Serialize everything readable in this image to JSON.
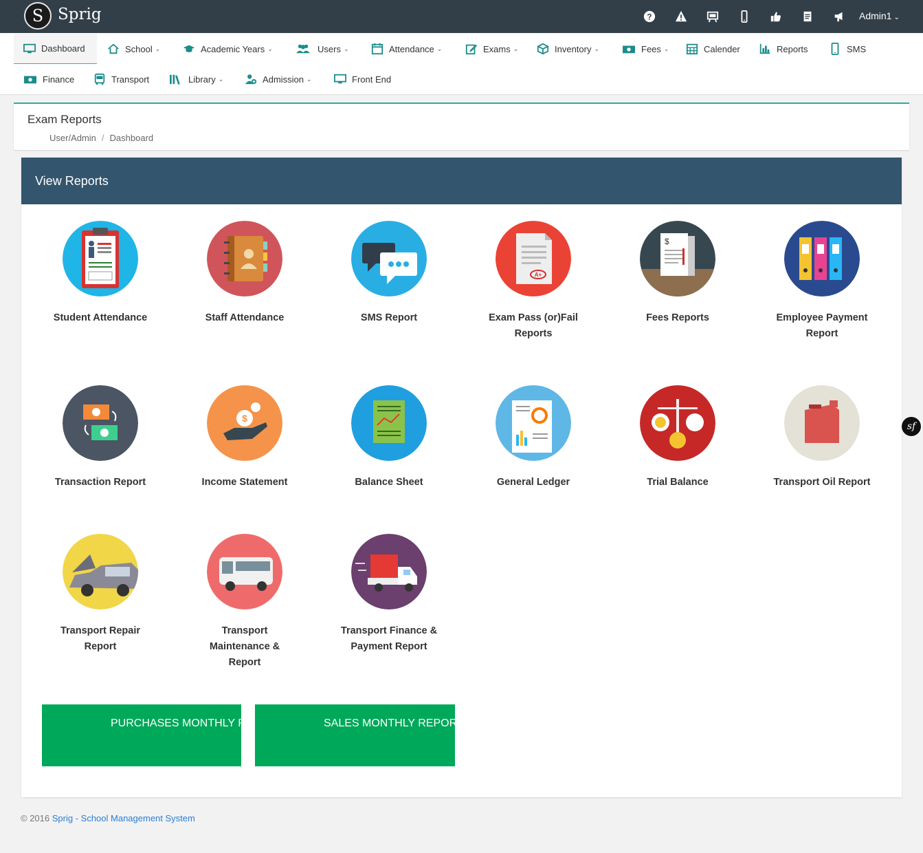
{
  "app": {
    "brand": "Sprig",
    "logo_letter": "S"
  },
  "topbar": {
    "icons": [
      "help-icon",
      "warning-icon",
      "presentation-icon",
      "mobile-icon",
      "thumbs-up-icon",
      "document-icon",
      "megaphone-icon"
    ],
    "user": {
      "name": "Admin1",
      "caret": "⌄"
    }
  },
  "nav": {
    "caret": "⌄",
    "dashboard": "Dashboard",
    "school": "School",
    "academic_years": "Academic Years",
    "users": "Users",
    "attendance": "Attendance",
    "exams": "Exams",
    "inventory": "Inventory",
    "fees": "Fees",
    "calender": "Calender",
    "reports": "Reports",
    "sms": "SMS",
    "finance": "Finance",
    "transport": "Transport",
    "library": "Library",
    "admission": "Admission",
    "front_end": "Front End"
  },
  "page": {
    "title": "Exam Reports",
    "breadcrumb": [
      "User/Admin",
      "Dashboard"
    ],
    "breadcrumb_sep": "/"
  },
  "panel": {
    "title": "View Reports",
    "tiles": [
      {
        "label": "Student Attendance",
        "icon": "clipboard-icon",
        "color": "#1fb5e6"
      },
      {
        "label": "Staff Attendance",
        "icon": "contact-book-icon",
        "color": "#d0555a"
      },
      {
        "label": "SMS Report",
        "icon": "chat-bubble-icon",
        "color": "#29aee4"
      },
      {
        "label": "Exam Pass (or)Fail Reports",
        "icon": "exam-paper-icon",
        "color": "#ea4335"
      },
      {
        "label": "Fees Reports",
        "icon": "invoice-icon",
        "color": "#37474f"
      },
      {
        "label": "Employee Payment Report",
        "icon": "binders-icon",
        "color": "#2a4a8f"
      },
      {
        "label": "Transaction Report",
        "icon": "money-exchange-icon",
        "color": "#4b5563"
      },
      {
        "label": "Income Statement",
        "icon": "hand-coin-icon",
        "color": "#f5934a"
      },
      {
        "label": "Balance Sheet",
        "icon": "chart-sheet-icon",
        "color": "#1f9fe0"
      },
      {
        "label": "General Ledger",
        "icon": "ledger-icon",
        "color": "#5fb7e5"
      },
      {
        "label": "Trial Balance",
        "icon": "scale-icon",
        "color": "#c62828"
      },
      {
        "label": "Transport Oil Report",
        "icon": "oil-can-icon",
        "color": "#e4e1d6"
      },
      {
        "label": "Transport Repair Report",
        "icon": "car-repair-icon",
        "color": "#f1d647"
      },
      {
        "label": "Transport Maintenance & Report",
        "icon": "bus-icon",
        "color": "#ef6b6b"
      },
      {
        "label": "Transport Finance & Payment Report",
        "icon": "truck-icon",
        "color": "#6b3f6e"
      }
    ],
    "buttons": {
      "purchases": "PURCHASES MONTHLY REPORT",
      "sales": "SALES MONTHLY REPORT"
    }
  },
  "footer": {
    "copyright": "© 2016",
    "link": "Sprig - School Management System"
  },
  "badge": {
    "text": "sf"
  }
}
